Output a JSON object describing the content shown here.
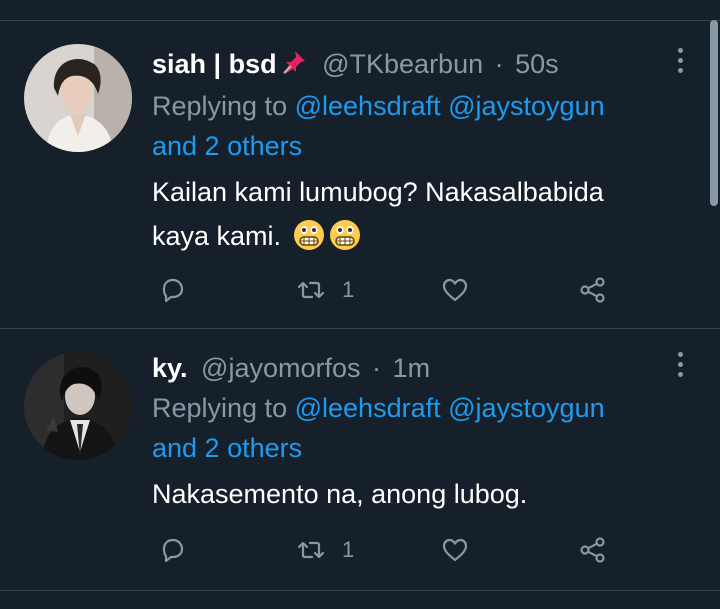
{
  "tweets": [
    {
      "display_name": "siah | bsd",
      "name_emoji": "pushpin-icon",
      "handle": "@TKbearbun",
      "dot": "·",
      "time": "50s",
      "replying_prefix": "Replying to",
      "replying_users": [
        "@leehsdraft",
        "@jaystoygun"
      ],
      "replying_others": "and 2 others",
      "text_line1": "Kailan kami lumubog? Nakasalbabida",
      "text_line2": "kaya kami.",
      "emojis": [
        "grimacing-face-icon",
        "grimacing-face-icon"
      ],
      "retweet_count": "1"
    },
    {
      "display_name": "ky.",
      "handle": "@jayomorfos",
      "dot": "·",
      "time": "1m",
      "replying_prefix": "Replying to",
      "replying_users": [
        "@leehsdraft",
        "@jaystoygun"
      ],
      "replying_others": "and 2 others",
      "text_line1": "Nakasemento na, anong lubog.",
      "retweet_count": "1"
    }
  ],
  "colors": {
    "background": "#15202b",
    "text": "#ffffff",
    "muted": "#8899a6",
    "link": "#1d9bf0",
    "separator": "#38444d"
  }
}
